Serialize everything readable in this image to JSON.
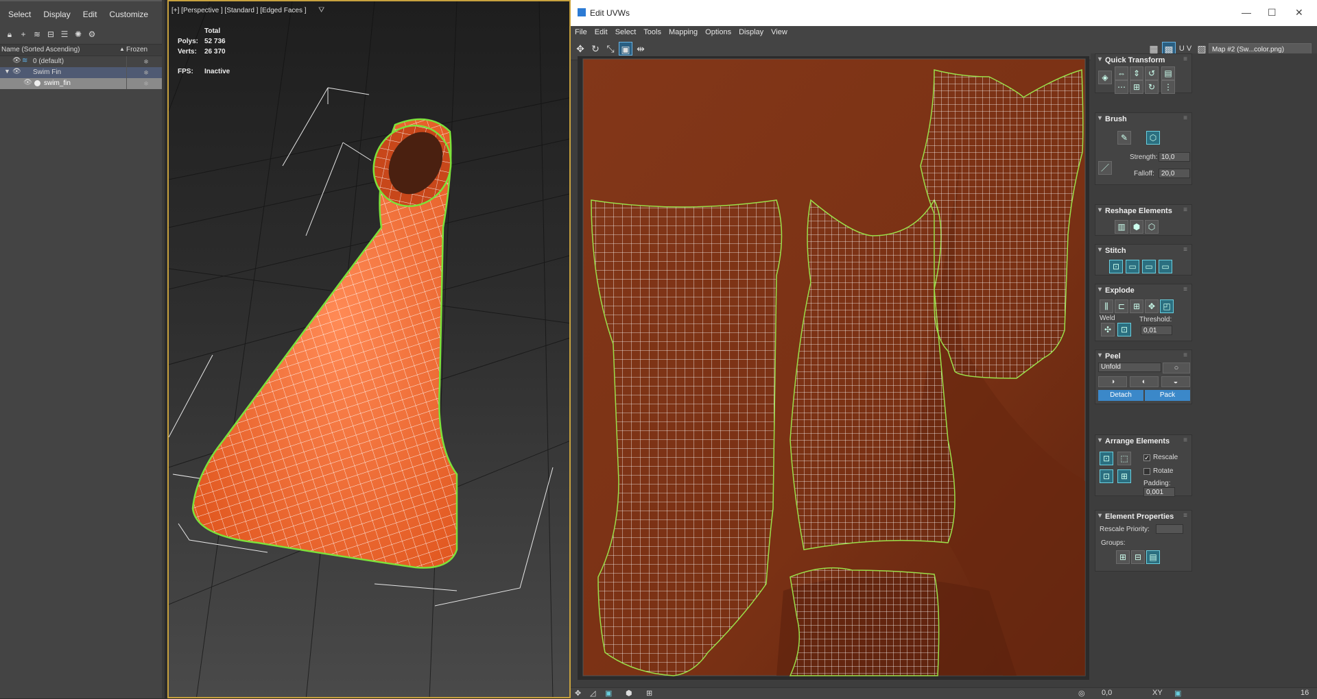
{
  "explorer": {
    "menu": [
      "Select",
      "Display",
      "Edit",
      "Customize"
    ],
    "toolbar_icons": [
      "lock-icon",
      "add-layer-icon",
      "layers-icon",
      "hierarchy-icon",
      "layer-stack-icon",
      "light-icon",
      "settings-icon"
    ],
    "columns": {
      "name": "Name (Sorted Ascending)",
      "sort_glyph": "▲",
      "frozen": "Frozen"
    },
    "rows": [
      {
        "name": "0 (default)"
      },
      {
        "name": "Swim Fin"
      },
      {
        "name": "swim_fin"
      }
    ],
    "frozen_glyph": "❄"
  },
  "viewport": {
    "label": "[+] [Perspective ] [Standard ] [Edged Faces ]",
    "stats": {
      "total_label": "Total",
      "polys_label": "Polys:",
      "polys": "52 736",
      "verts_label": "Verts:",
      "verts": "26 370",
      "fps_label": "FPS:",
      "fps": "Inactive"
    }
  },
  "uv_window": {
    "title": "Edit UVWs",
    "window_buttons": [
      "—",
      "☐",
      "✕"
    ],
    "menu": [
      "File",
      "Edit",
      "Select",
      "Tools",
      "Mapping",
      "Options",
      "Display",
      "View"
    ],
    "uv_label": "U V",
    "map_dropdown": "Map #2 (Sw...color.png)",
    "bottom": {
      "value1": "0,0",
      "xy": "XY",
      "zoom": "16"
    }
  },
  "panel": {
    "quick_transform": "Quick Transform",
    "brush": {
      "title": "Brush",
      "strength_label": "Strength:",
      "strength": "10,0",
      "falloff_label": "Falloff:",
      "falloff": "20,0"
    },
    "reshape_elements": "Reshape Elements",
    "stitch": "Stitch",
    "explode": {
      "title": "Explode",
      "weld_label": "Weld",
      "threshold_label": "Threshold:",
      "threshold": "0,01"
    },
    "peel": {
      "title": "Peel",
      "mode": "Unfold",
      "detach": "Detach",
      "pack": "Pack"
    },
    "arrange": {
      "title": "Arrange Elements",
      "rescale": "Rescale",
      "rescale_checked": true,
      "rotate": "Rotate",
      "rotate_checked": false,
      "padding_label": "Padding:",
      "padding": "0,001"
    },
    "element_properties": {
      "title": "Element Properties",
      "rescale_priority_label": "Rescale Priority:",
      "groups_label": "Groups:"
    }
  },
  "colors": {
    "fin_orange": "#f0652a",
    "uv_bg": "#7a3216",
    "uv_edge": "#9be04a",
    "viewport_border": "#c8a23e",
    "accent_blue": "#3b88c9"
  }
}
